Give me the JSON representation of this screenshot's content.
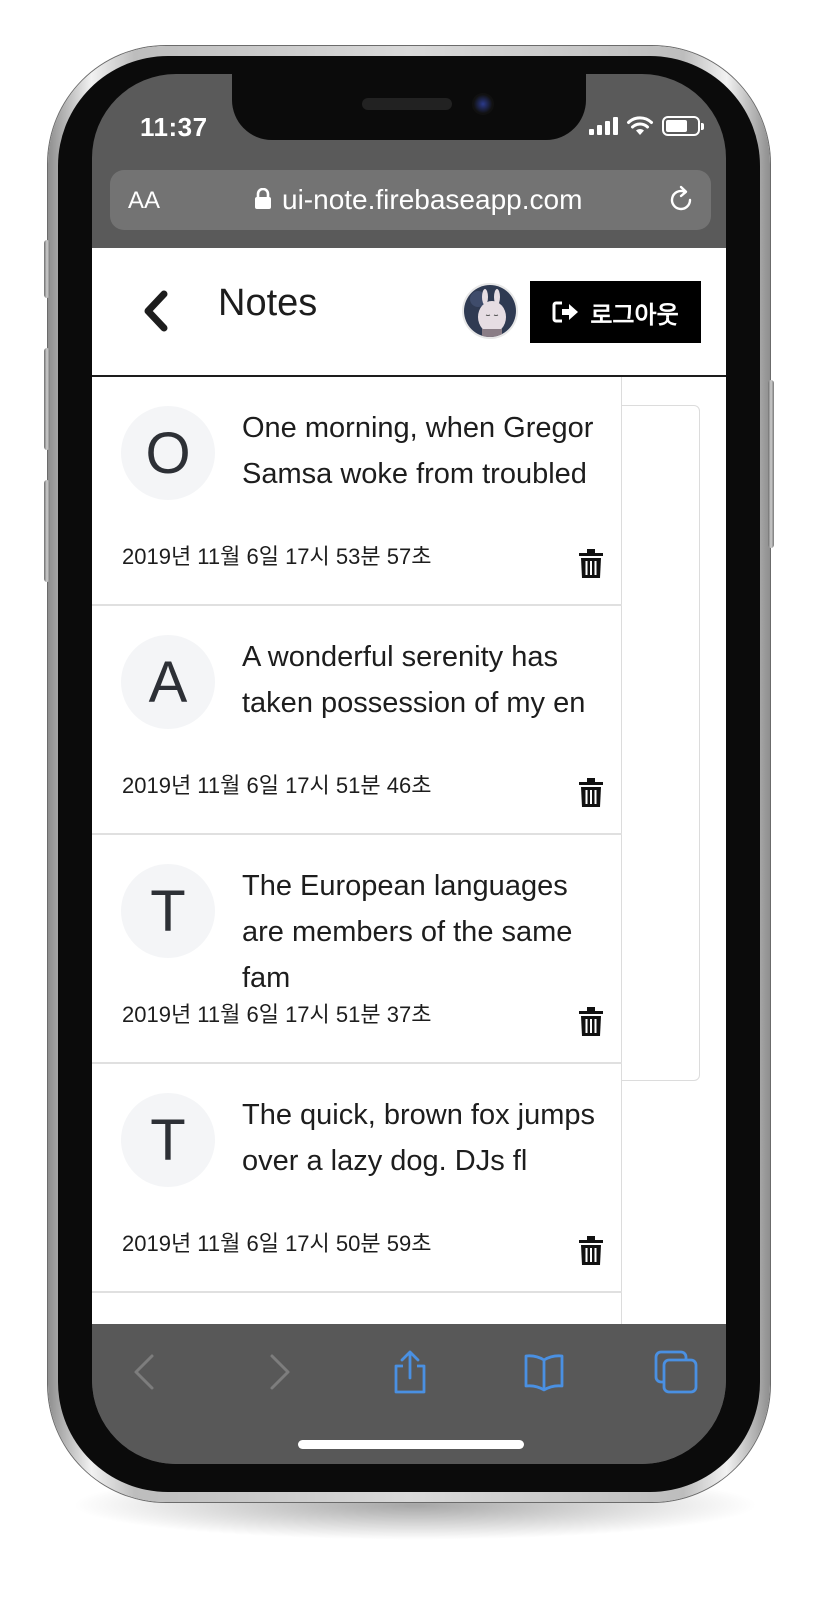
{
  "status_bar": {
    "time": "11:37"
  },
  "browser": {
    "text_size_label": "AA",
    "url": "ui-note.firebaseapp.com"
  },
  "app": {
    "title": "Notes",
    "logout_label": "로그아웃"
  },
  "notes": [
    {
      "initial": "O",
      "text": "One morning, when Gregor Samsa woke from troubled",
      "date": "2019년 11월 6일 17시 53분 57초"
    },
    {
      "initial": "A",
      "text": "A wonderful serenity has taken possession of my en",
      "date": "2019년 11월 6일 17시 51분 46초"
    },
    {
      "initial": "T",
      "text": "The European languages are members of the same fam",
      "date": "2019년 11월 6일 17시 51분 37초"
    },
    {
      "initial": "T",
      "text": "The quick, brown fox jumps over a lazy dog. DJs fl",
      "date": "2019년 11월 6일 17시 50분 59초"
    }
  ],
  "toolbar": {
    "icons": [
      "back-arrow-icon",
      "forward-arrow-icon",
      "share-icon",
      "bookmarks-icon",
      "tabs-icon"
    ],
    "accent": "#4a90e2"
  }
}
